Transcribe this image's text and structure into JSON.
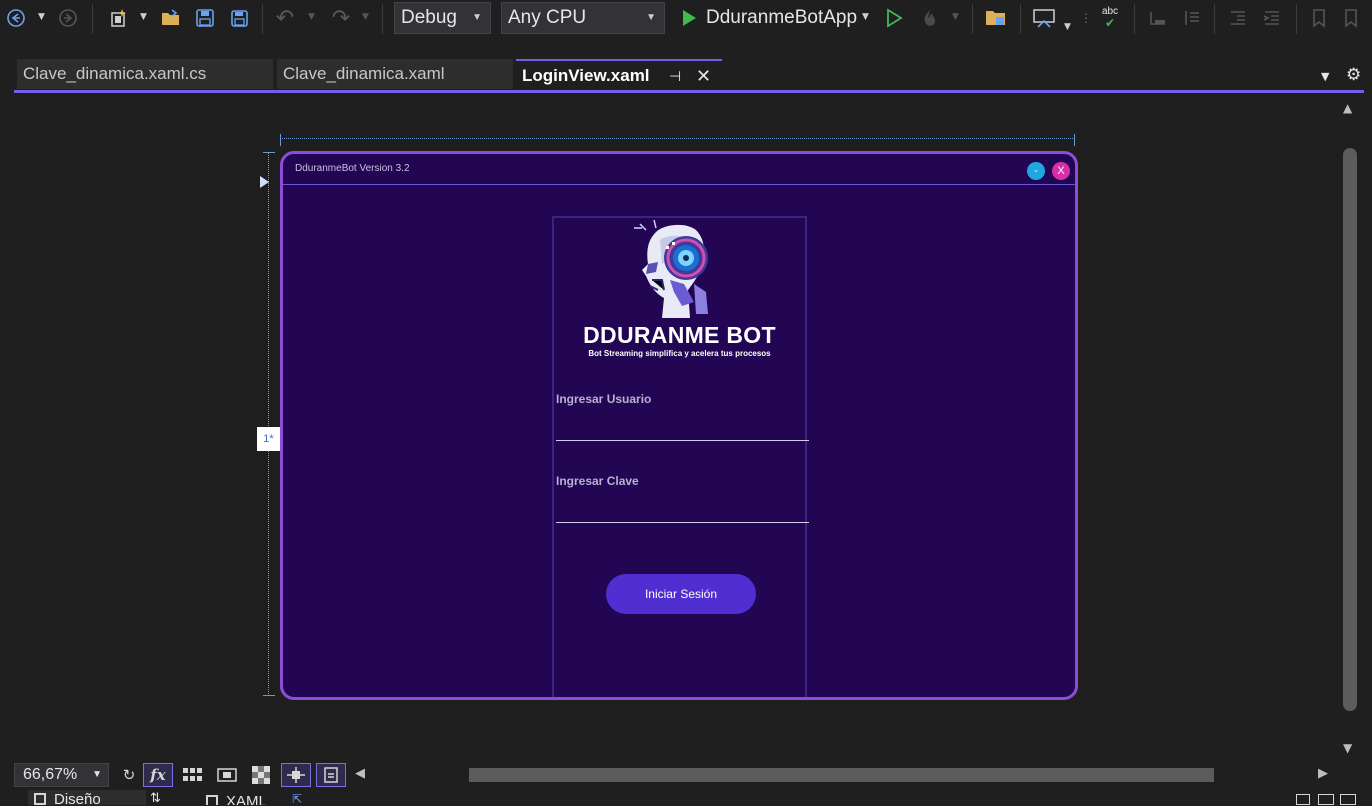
{
  "toolbar": {
    "config": "Debug",
    "platform": "Any CPU",
    "startup_project": "DduranmeBotApp",
    "spell_label": "abc"
  },
  "tabs": [
    {
      "label": "Clave_dinamica.xaml.cs"
    },
    {
      "label": "Clave_dinamica.xaml"
    },
    {
      "label": "LoginView.xaml"
    }
  ],
  "login": {
    "window_title": "DduranmeBot Version 3.2",
    "minimize_label": "-",
    "close_label": "X",
    "brand": "DDURANME BOT",
    "tagline": "Bot Streaming simplifica y acelera tus procesos",
    "user_label": "Ingresar Usuario",
    "password_label": "Ingresar Clave",
    "button": "Iniciar Sesión"
  },
  "designer": {
    "zoom": "66,67%",
    "row_marker": "1*",
    "fx_label": "fx"
  },
  "footer": {
    "design_tab": "Diseño",
    "xaml_tab": "XAML"
  }
}
